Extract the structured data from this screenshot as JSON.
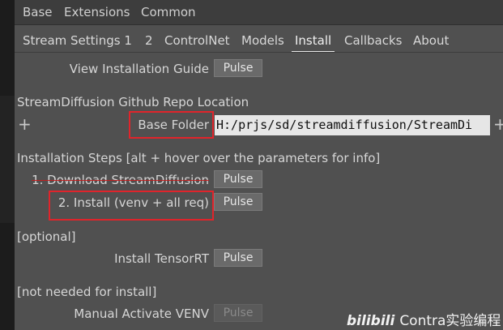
{
  "menu": [
    "Base",
    "Extensions",
    "Common"
  ],
  "tabs": [
    {
      "label": "Stream Settings 1",
      "active": false
    },
    {
      "label": "2",
      "active": false
    },
    {
      "label": "ControlNet",
      "active": false
    },
    {
      "label": "Models",
      "active": false
    },
    {
      "label": "Install",
      "active": true
    },
    {
      "label": "Callbacks",
      "active": false
    },
    {
      "label": "About",
      "active": false
    }
  ],
  "view_guide": {
    "label": "View Installation Guide",
    "button": "Pulse"
  },
  "repo": {
    "heading": "StreamDiffusion Github Repo Location",
    "base_folder_label": "Base Folder",
    "base_folder_value": "H:/prjs/sd/streamdiffusion/StreamDi"
  },
  "steps": {
    "heading": "Installation Steps [alt + hover over the parameters for info]",
    "step1": {
      "label": "1. Download StreamDiffusion",
      "button": "Pulse"
    },
    "step2": {
      "label": "2. Install (venv + all req)",
      "button": "Pulse"
    }
  },
  "optional": {
    "heading": "[optional]",
    "label": "Install TensorRT",
    "button": "Pulse"
  },
  "not_needed": {
    "heading": "[not needed for install]",
    "label": "Manual Activate VENV",
    "button": "Pulse"
  },
  "watermark": {
    "logo": "bilibili",
    "text": "Contra实验编程"
  },
  "colors": {
    "panel": "#505050",
    "highlight": "#e0242b",
    "field": "#e6e6e6"
  }
}
